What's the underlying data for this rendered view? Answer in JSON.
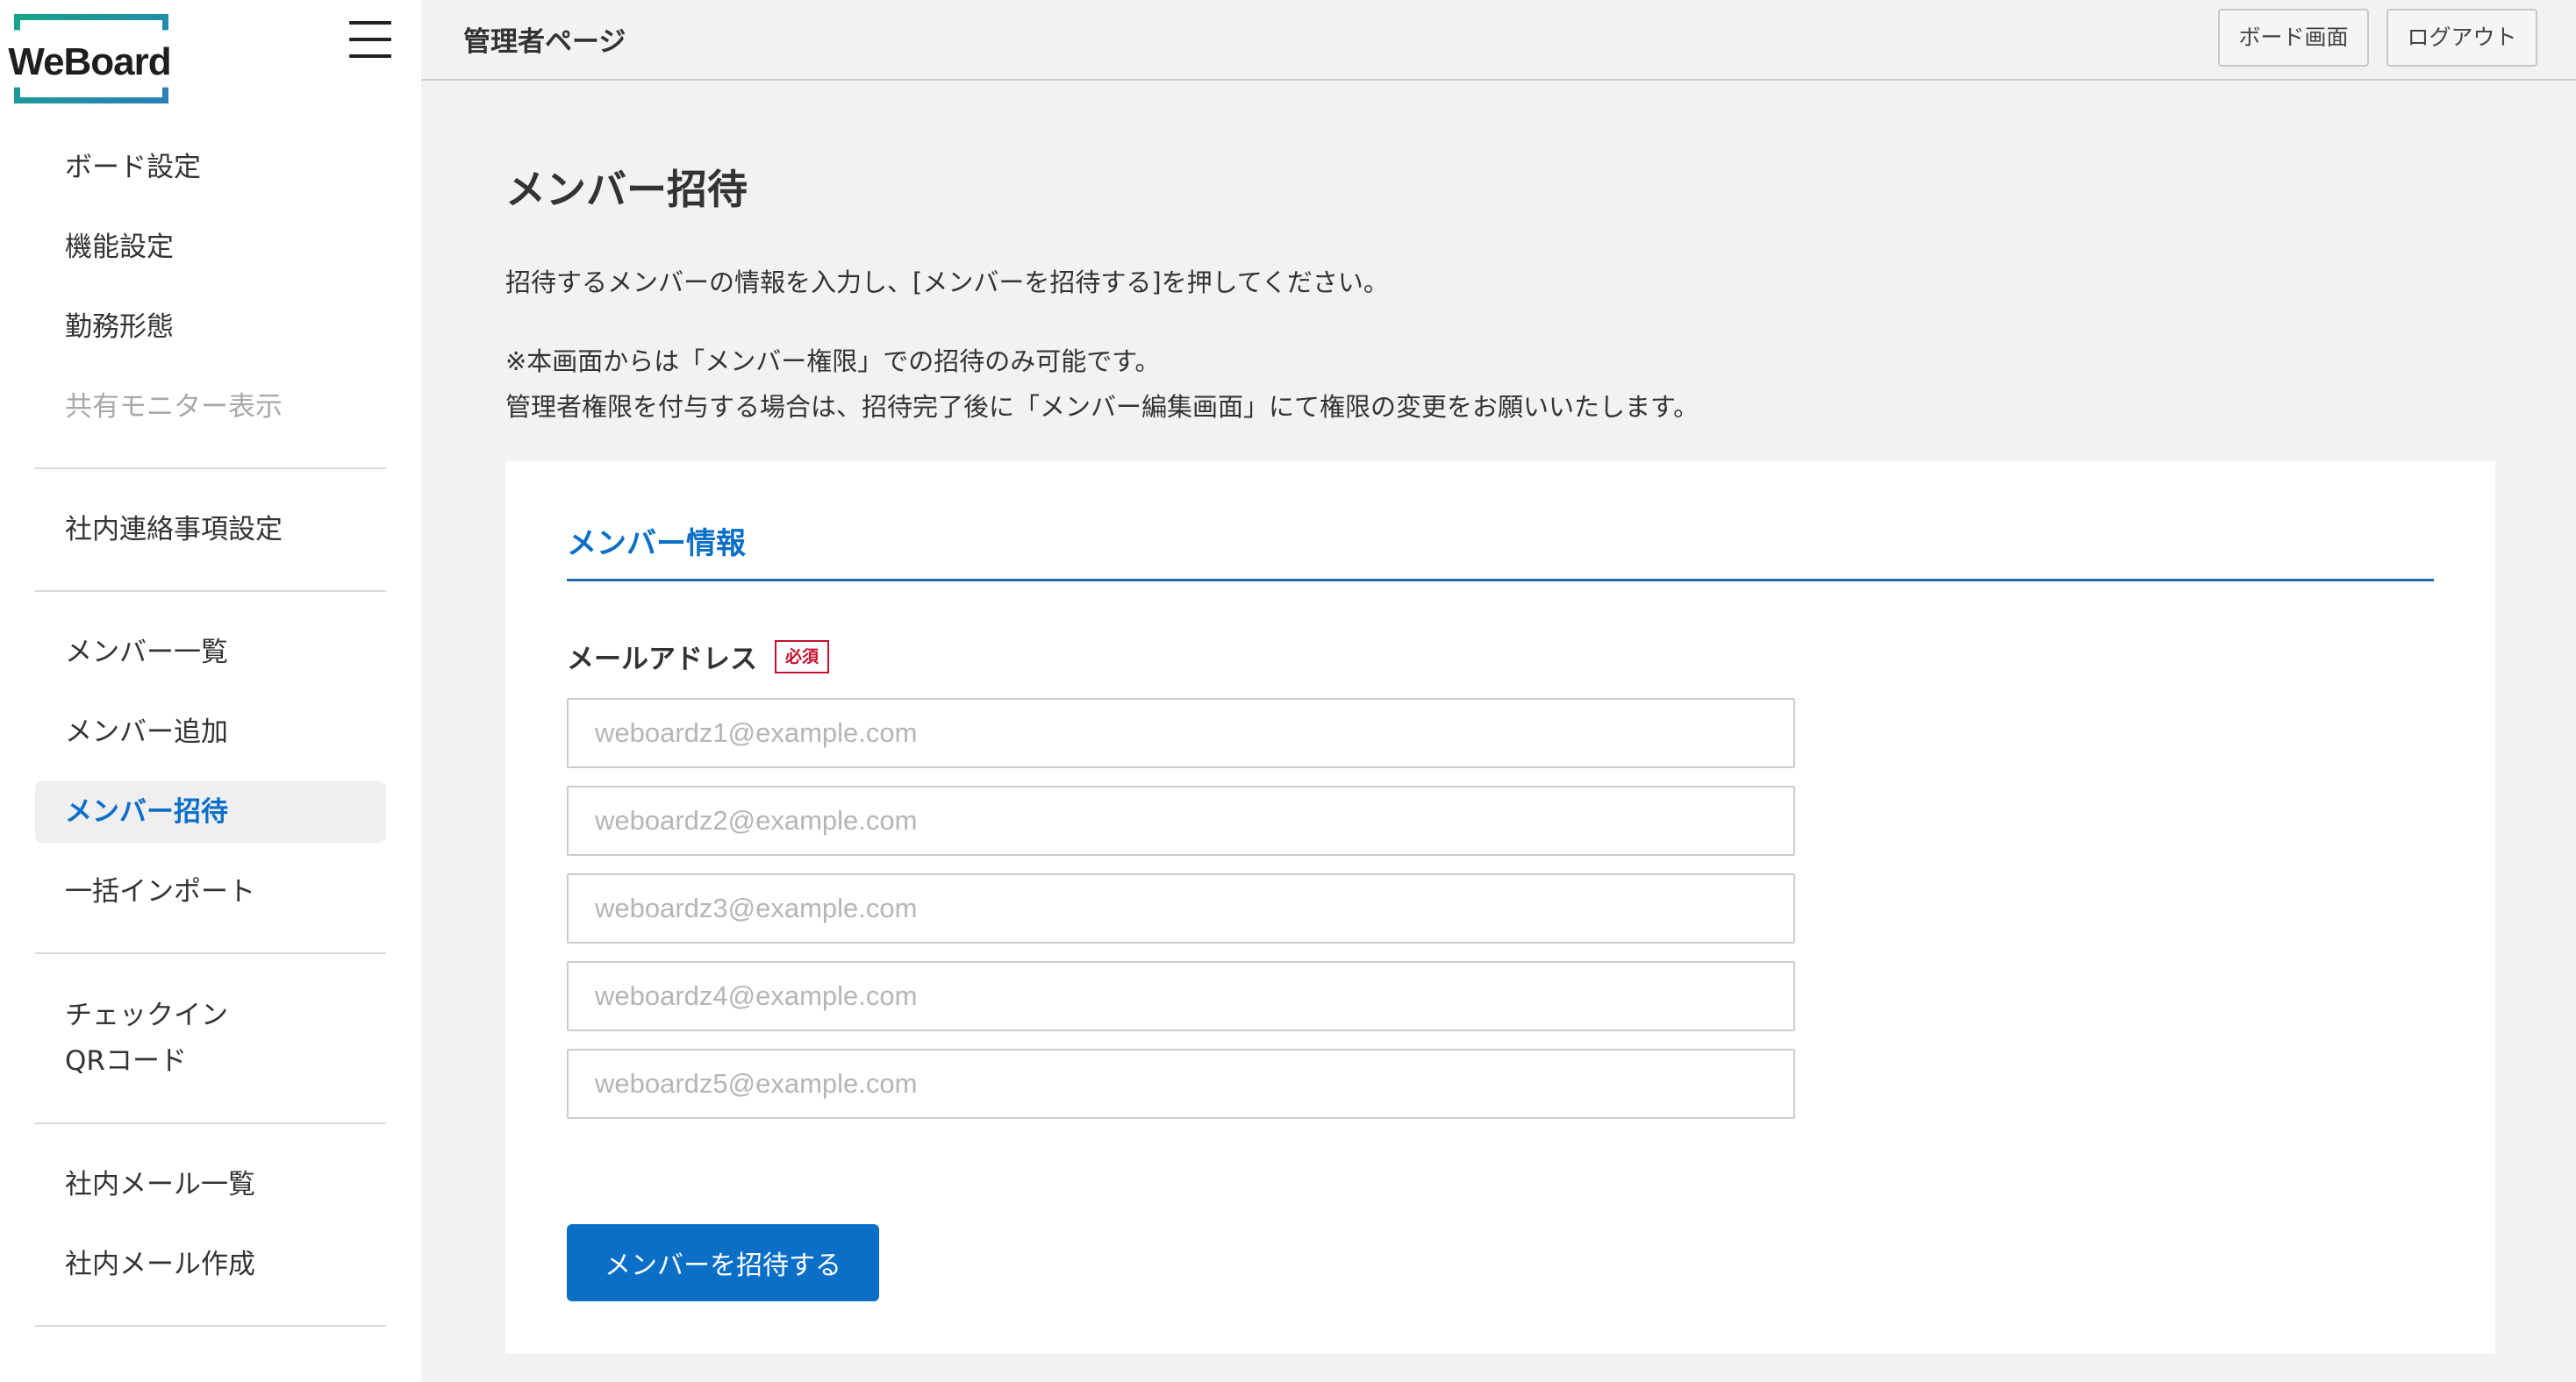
{
  "brand": {
    "logo_text": "WeBoard"
  },
  "header": {
    "title": "管理者ページ",
    "board_button": "ボード画面",
    "logout_button": "ログアウト"
  },
  "sidebar": {
    "groups": [
      {
        "items": [
          {
            "label": "ボード設定",
            "state": "normal"
          },
          {
            "label": "機能設定",
            "state": "normal"
          },
          {
            "label": "勤務形態",
            "state": "normal"
          },
          {
            "label": "共有モニター表示",
            "state": "disabled"
          }
        ]
      },
      {
        "items": [
          {
            "label": "社内連絡事項設定",
            "state": "normal"
          }
        ]
      },
      {
        "items": [
          {
            "label": "メンバー一覧",
            "state": "normal"
          },
          {
            "label": "メンバー追加",
            "state": "normal"
          },
          {
            "label": "メンバー招待",
            "state": "active"
          },
          {
            "label": "一括インポート",
            "state": "normal"
          }
        ]
      },
      {
        "items": [
          {
            "label_line1": "チェックイン",
            "label_line2": "QRコード",
            "state": "normal"
          }
        ]
      },
      {
        "items": [
          {
            "label": "社内メール一覧",
            "state": "normal"
          },
          {
            "label": "社内メール作成",
            "state": "normal"
          }
        ]
      }
    ]
  },
  "main": {
    "heading": "メンバー招待",
    "description": "招待するメンバーの情報を入力し、[メンバーを招待する]を押してください。",
    "note_line1": "※本画面からは「メンバー権限」での招待のみ可能です。",
    "note_line2": "管理者権限を付与する場合は、招待完了後に「メンバー編集画面」にて権限の変更をお願いいたします。",
    "section_title": "メンバー情報",
    "email_label": "メールアドレス",
    "required_badge": "必須",
    "email_fields": [
      {
        "value": "",
        "placeholder": "weboardz1@example.com"
      },
      {
        "value": "",
        "placeholder": "weboardz2@example.com"
      },
      {
        "value": "",
        "placeholder": "weboardz3@example.com"
      },
      {
        "value": "",
        "placeholder": "weboardz4@example.com"
      },
      {
        "value": "",
        "placeholder": "weboardz5@example.com"
      }
    ],
    "submit_label": "メンバーを招待する"
  },
  "colors": {
    "accent": "#0b6fc8",
    "required": "#c8102e",
    "rule": "#1f6aa7"
  }
}
